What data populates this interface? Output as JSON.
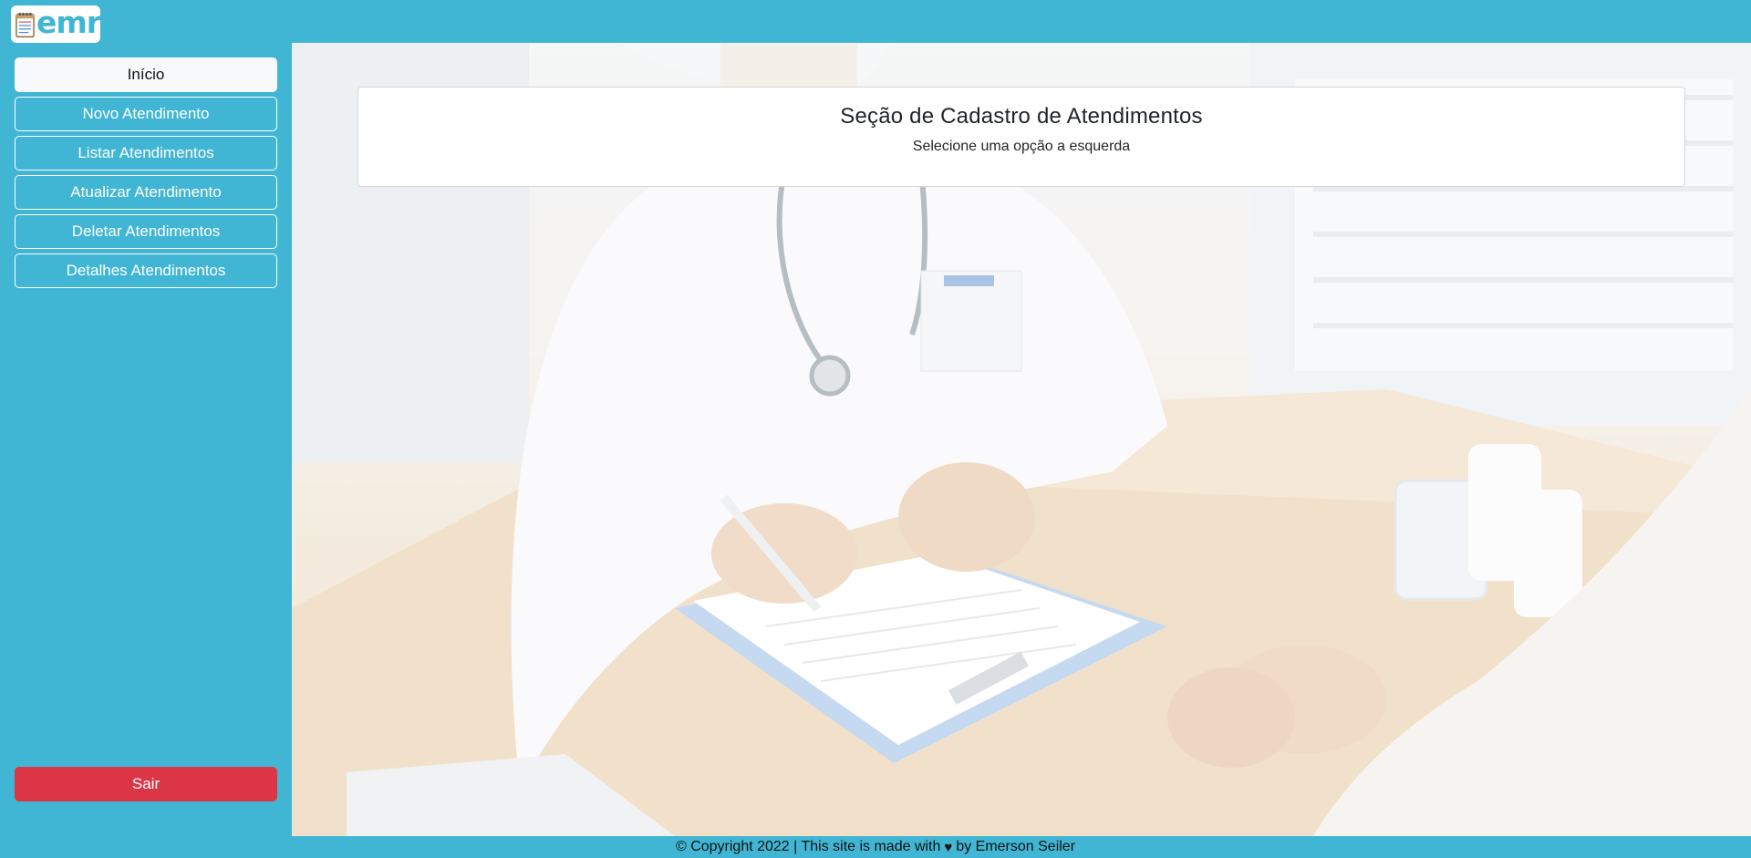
{
  "header": {
    "logo_text": "emr",
    "logo_icon": "notepad-icon"
  },
  "sidebar": {
    "items": [
      {
        "label": "Início",
        "active": true
      },
      {
        "label": "Novo Atendimento",
        "active": false
      },
      {
        "label": "Listar Atendimentos",
        "active": false
      },
      {
        "label": "Atualizar Atendimento",
        "active": false
      },
      {
        "label": "Deletar Atendimentos",
        "active": false
      },
      {
        "label": "Detalhes Atendimentos",
        "active": false
      }
    ],
    "logout_label": "Sair"
  },
  "main": {
    "title": "Seção de Cadastro de Atendimentos",
    "subtitle": "Selecione uma opção a esquerda"
  },
  "footer": {
    "prefix": "© Copyright 2022 | This site is made with",
    "suffix": "by Emerson Seiler",
    "icon": "heart-icon"
  },
  "colors": {
    "brand": "#41b6d4",
    "danger": "#dc3545",
    "active_bg": "#f8f9fa"
  }
}
